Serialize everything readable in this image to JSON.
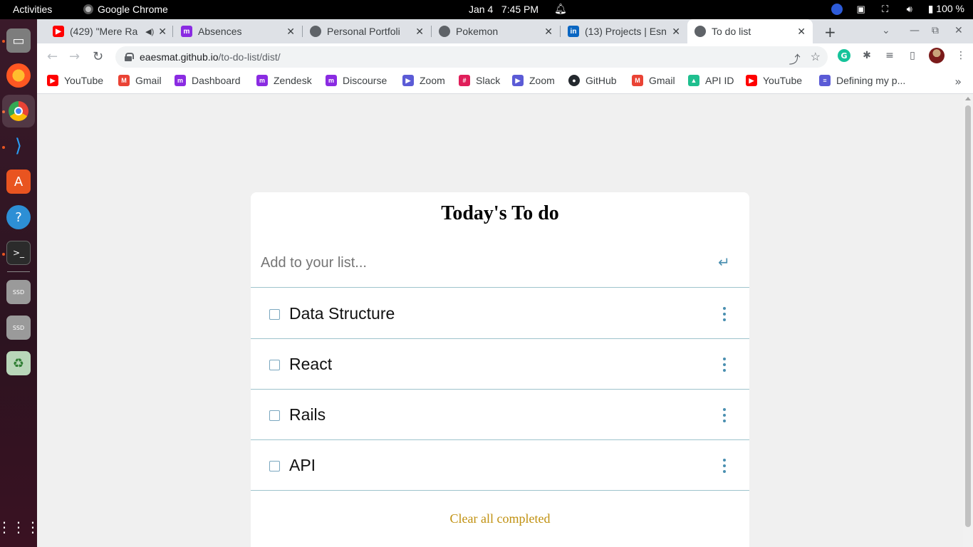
{
  "topbar": {
    "activities": "Activities",
    "app_name": "Google Chrome",
    "date": "Jan 4",
    "time": "7:45 PM",
    "battery": "100 %"
  },
  "tabs": [
    {
      "title": "(429) \"Mere Ra",
      "favicon": "youtube-icon",
      "color": "#ff0000"
    },
    {
      "title": "Absences",
      "favicon": "brand-icon",
      "color": "#8a2be2"
    },
    {
      "title": "Personal Portfoli",
      "favicon": "globe-icon",
      "color": "#5f6368"
    },
    {
      "title": "Pokemon",
      "favicon": "globe-icon",
      "color": "#5f6368"
    },
    {
      "title": "(13) Projects | Esn",
      "favicon": "linkedin-icon",
      "color": "#0a66c2"
    },
    {
      "title": "To do list",
      "favicon": "globe-icon",
      "color": "#5f6368"
    }
  ],
  "address": {
    "host": "eaesmat.github.io",
    "path": "/to-do-list/dist/"
  },
  "bookmarks": [
    {
      "label": "YouTube",
      "icon": "youtube-icon",
      "color": "#ff0000"
    },
    {
      "label": "Gmail",
      "icon": "gmail-icon",
      "color": "#ea4335"
    },
    {
      "label": "Dashboard",
      "icon": "brand-icon",
      "color": "#8a2be2"
    },
    {
      "label": "Zendesk",
      "icon": "brand-icon",
      "color": "#8a2be2"
    },
    {
      "label": "Discourse",
      "icon": "brand-icon",
      "color": "#8a2be2"
    },
    {
      "label": "Zoom",
      "icon": "zoom-icon",
      "color": "#5b5bd6"
    },
    {
      "label": "Slack",
      "icon": "slack-icon",
      "color": "#e01e5a"
    },
    {
      "label": "Zoom",
      "icon": "zoom-icon",
      "color": "#5b5bd6"
    },
    {
      "label": "GitHub",
      "icon": "github-icon",
      "color": "#24292e"
    },
    {
      "label": "Gmail",
      "icon": "gmail-icon",
      "color": "#ea4335"
    },
    {
      "label": "API ID",
      "icon": "api-icon",
      "color": "#1fbf8f"
    },
    {
      "label": "YouTube",
      "icon": "youtube-icon",
      "color": "#ff0000"
    },
    {
      "label": "Defining my p...",
      "icon": "docs-icon",
      "color": "#5b5bd6"
    }
  ],
  "app": {
    "title": "Today's To do",
    "input_placeholder": "Add to your list...",
    "todos": [
      {
        "label": "Data Structure",
        "done": false
      },
      {
        "label": "React",
        "done": false
      },
      {
        "label": "Rails",
        "done": false
      },
      {
        "label": "API",
        "done": false
      }
    ],
    "clear_label": "Clear all completed",
    "accent_color": "#4a8fb0",
    "clear_color": "#c0900f"
  }
}
